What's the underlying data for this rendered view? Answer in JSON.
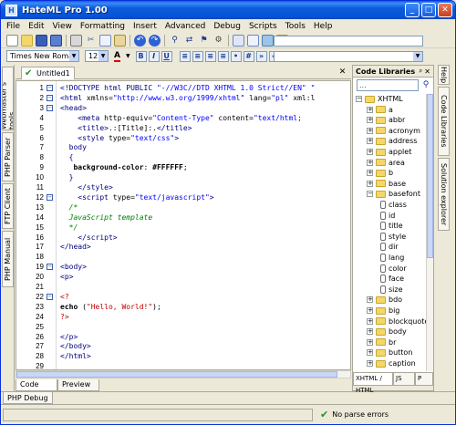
{
  "window": {
    "title": "HateML Pro 1.00",
    "minimize": "_",
    "maximize": "□",
    "close": "✕"
  },
  "menu": [
    "File",
    "Edit",
    "View",
    "Formatting",
    "Insert",
    "Advanced",
    "Debug",
    "Scripts",
    "Tools",
    "Help"
  ],
  "toolbar_icons": [
    "new-file",
    "open-folder",
    "save",
    "save-all",
    "print",
    "cut",
    "copy",
    "paste",
    "undo",
    "redo",
    "search",
    "replace",
    "bookmark",
    "tools",
    "options",
    "chart",
    "table",
    "image",
    "note"
  ],
  "format": {
    "font": "Times New Roman",
    "size": "12",
    "text_color_label": "A",
    "bold": "B",
    "italic": "I",
    "underline": "U"
  },
  "left_tabs": [
    "Webmaster's tools",
    "PHP Parser",
    "FTP Client",
    "PHP Manual"
  ],
  "document_tab": "Untitled1",
  "code_lines": [
    {
      "n": "1",
      "fold": "−",
      "html": "<span class='tag'>&lt;!DOCTYPE html PUBLIC</span> <span class='str'>\"-//W3C//DTD XHTML 1.0 Strict//EN\"</span> <span class='str'>\"</span>"
    },
    {
      "n": "2",
      "fold": "−",
      "html": "<span class='tag'>&lt;html</span> xmlns=<span class='str'>\"http://www.w3.org/1999/xhtml\"</span> lang=<span class='str'>\"pl\"</span> xml:l"
    },
    {
      "n": "3",
      "fold": "−",
      "html": "<span class='tag'>&lt;head&gt;</span>"
    },
    {
      "n": "4",
      "fold": "",
      "html": "    <span class='tag'>&lt;meta</span> http-equiv=<span class='str'>\"Content-Type\"</span> content=<span class='str'>\"text/html;</span>"
    },
    {
      "n": "5",
      "fold": "",
      "html": "    <span class='tag'>&lt;title&gt;</span>.:[Title]:.<span class='tag'>&lt;/title&gt;</span>"
    },
    {
      "n": "6",
      "fold": "",
      "html": "    <span class='tag'>&lt;style</span> type=<span class='str'>\"text/css\"</span><span class='tag'>&gt;</span>"
    },
    {
      "n": "7",
      "fold": "",
      "html": "  <span class='tag'>body</span>"
    },
    {
      "n": "8",
      "fold": "",
      "html": "  <span class='tag'>{</span>"
    },
    {
      "n": "9",
      "fold": "",
      "html": "   <span class='kw'>background-color</span>: <span class='kw'>#FFFFFF</span>;"
    },
    {
      "n": "10",
      "fold": "",
      "html": "  <span class='tag'>}</span>"
    },
    {
      "n": "11",
      "fold": "",
      "html": "    <span class='tag'>&lt;/style&gt;</span>"
    },
    {
      "n": "12",
      "fold": "−",
      "html": "    <span class='tag'>&lt;script</span> type=<span class='str'>\"text/javascript\"</span><span class='tag'>&gt;</span>"
    },
    {
      "n": "13",
      "fold": "",
      "html": "  <span class='cmt'>/*</span>"
    },
    {
      "n": "14",
      "fold": "",
      "html": "  <span class='cmt'>JavaScript template</span>"
    },
    {
      "n": "15",
      "fold": "",
      "html": "  <span class='cmt'>*/</span>"
    },
    {
      "n": "16",
      "fold": "",
      "html": "    <span class='tag'>&lt;/script&gt;</span>"
    },
    {
      "n": "17",
      "fold": "",
      "html": "<span class='tag'>&lt;/head&gt;</span>"
    },
    {
      "n": "18",
      "fold": "",
      "html": ""
    },
    {
      "n": "19",
      "fold": "−",
      "html": "<span class='tag'>&lt;body&gt;</span>"
    },
    {
      "n": "20",
      "fold": "",
      "html": "<span class='tag'>&lt;p&gt;</span>"
    },
    {
      "n": "21",
      "fold": "",
      "html": ""
    },
    {
      "n": "22",
      "fold": "−",
      "html": "<span class='red'>&lt;?</span>"
    },
    {
      "n": "23",
      "fold": "",
      "html": "<span class='kw'>echo</span> (<span class='red'>\"Hello, World!\"</span>);"
    },
    {
      "n": "24",
      "fold": "",
      "html": "<span class='red'>?&gt;</span>"
    },
    {
      "n": "25",
      "fold": "",
      "html": ""
    },
    {
      "n": "26",
      "fold": "",
      "html": "<span class='tag'>&lt;/p&gt;</span>"
    },
    {
      "n": "27",
      "fold": "",
      "html": "<span class='tag'>&lt;/body&gt;</span>"
    },
    {
      "n": "28",
      "fold": "",
      "html": "<span class='tag'>&lt;/html&gt;</span>"
    },
    {
      "n": "29",
      "fold": "",
      "html": ""
    }
  ],
  "editor_tabs": [
    "Code",
    "Preview"
  ],
  "bottom_panel_tab": "PHP Debug",
  "status": {
    "parse": "No parse errors"
  },
  "code_libraries": {
    "title": "Code Libraries",
    "pin": "ᵖ",
    "close": "✕",
    "search_placeholder": "...",
    "tree": [
      {
        "label": "XHTML",
        "level": 0,
        "expanded": true,
        "type": "folder"
      },
      {
        "label": "a",
        "level": 1,
        "type": "folder"
      },
      {
        "label": "abbr",
        "level": 1,
        "type": "folder"
      },
      {
        "label": "acronym",
        "level": 1,
        "type": "folder"
      },
      {
        "label": "address",
        "level": 1,
        "type": "folder"
      },
      {
        "label": "applet",
        "level": 1,
        "type": "folder"
      },
      {
        "label": "area",
        "level": 1,
        "type": "folder"
      },
      {
        "label": "b",
        "level": 1,
        "type": "folder"
      },
      {
        "label": "base",
        "level": 1,
        "type": "folder"
      },
      {
        "label": "basefont",
        "level": 1,
        "expanded": true,
        "type": "folder"
      },
      {
        "label": "class",
        "level": 2,
        "type": "leaf"
      },
      {
        "label": "id",
        "level": 2,
        "type": "leaf"
      },
      {
        "label": "title",
        "level": 2,
        "type": "leaf"
      },
      {
        "label": "style",
        "level": 2,
        "type": "leaf"
      },
      {
        "label": "dir",
        "level": 2,
        "type": "leaf"
      },
      {
        "label": "lang",
        "level": 2,
        "type": "leaf"
      },
      {
        "label": "color",
        "level": 2,
        "type": "leaf"
      },
      {
        "label": "face",
        "level": 2,
        "type": "leaf"
      },
      {
        "label": "size",
        "level": 2,
        "type": "leaf"
      },
      {
        "label": "bdo",
        "level": 1,
        "type": "folder"
      },
      {
        "label": "big",
        "level": 1,
        "type": "folder"
      },
      {
        "label": "blockquote",
        "level": 1,
        "type": "folder"
      },
      {
        "label": "body",
        "level": 1,
        "type": "folder"
      },
      {
        "label": "br",
        "level": 1,
        "type": "folder"
      },
      {
        "label": "button",
        "level": 1,
        "type": "folder"
      },
      {
        "label": "caption",
        "level": 1,
        "type": "folder"
      }
    ],
    "tabs": [
      "XHTML / HTML",
      "JS",
      "P"
    ]
  },
  "right_tabs": [
    "Help",
    "Code Libraries",
    "Solution explorer"
  ]
}
